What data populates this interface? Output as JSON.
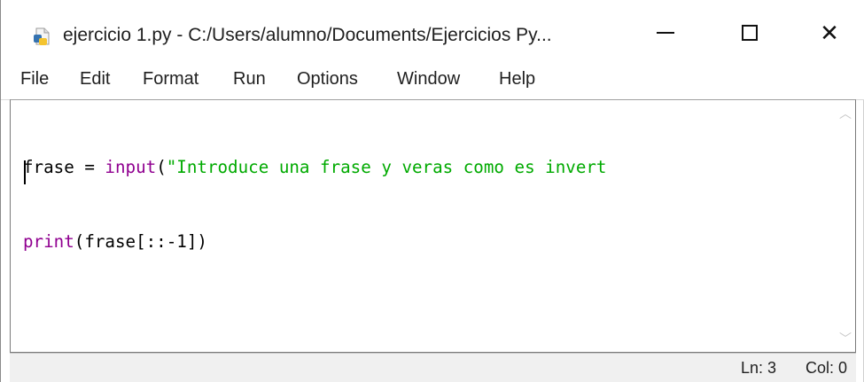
{
  "window": {
    "title": "ejercicio 1.py - C:/Users/alumno/Documents/Ejercicios Py...",
    "minimize_icon": "minimize-icon",
    "maximize_icon": "maximize-icon",
    "close_icon": "close-icon",
    "close_glyph": "✕"
  },
  "menu": {
    "items": [
      "File",
      "Edit",
      "Format",
      "Run",
      "Options",
      "Window",
      "Help"
    ]
  },
  "editor": {
    "line1": {
      "var": "frase",
      "op": " = ",
      "func": "input",
      "open": "(",
      "string": "\"Introduce una frase y veras como es invert"
    },
    "line2": {
      "func": "print",
      "rest": "(frase[::-1])"
    },
    "colors": {
      "builtin": "#900090",
      "string": "#00aa00",
      "default": "#000000"
    }
  },
  "scrollbar": {
    "up_glyph": "︿",
    "down_glyph": "﹀"
  },
  "status": {
    "line": "Ln: 3",
    "col": "Col: 0"
  }
}
